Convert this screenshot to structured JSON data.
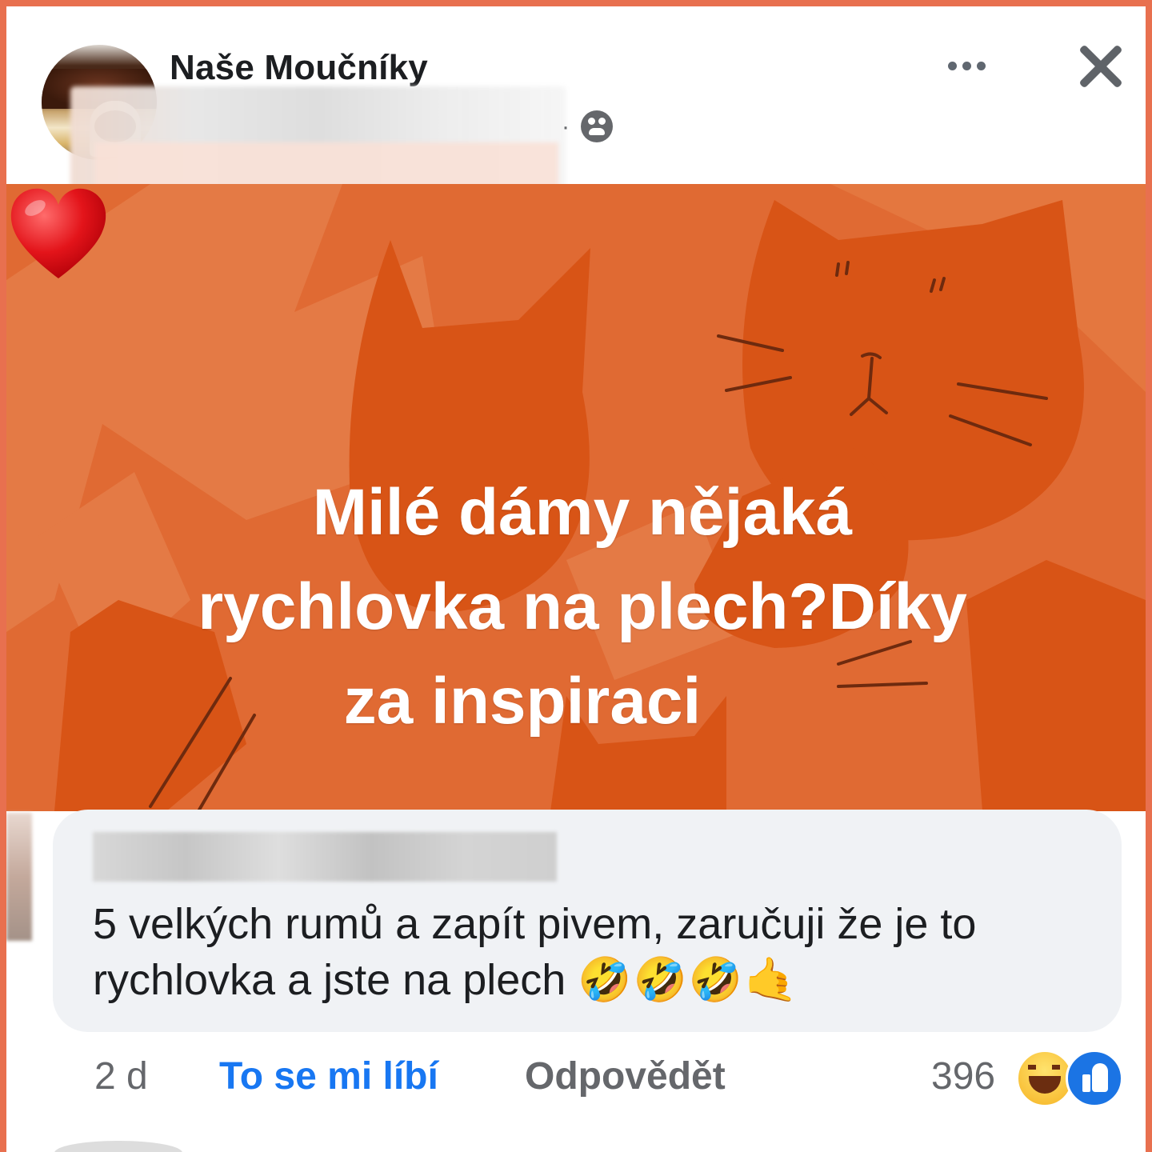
{
  "header": {
    "group_name": "Naše Moučníky",
    "separator": "·",
    "privacy_icon": "group-members-icon",
    "more_icon": "more-options-icon",
    "close_icon": "close-icon"
  },
  "post": {
    "background_color": "#e06a33",
    "lines": [
      "Milé dámy nějaká",
      "rychlovka na plech?Díky",
      "za inspiraci"
    ],
    "emoji": "heart-emoji"
  },
  "comment": {
    "text": "5 velkých rumů a zapít pivem, zaručuji že je to rychlovka a jste na plech",
    "emojis": "🤣🤣🤣🤙",
    "time": "2 d",
    "like_label": "To se mi líbí",
    "reply_label": "Odpovědět",
    "reaction_count": "396",
    "reactions": [
      "haha-reaction-icon",
      "like-reaction-icon"
    ]
  },
  "colors": {
    "frame": "#e8704f",
    "like_link": "#1877f2",
    "bubble": "#f0f2f5"
  }
}
